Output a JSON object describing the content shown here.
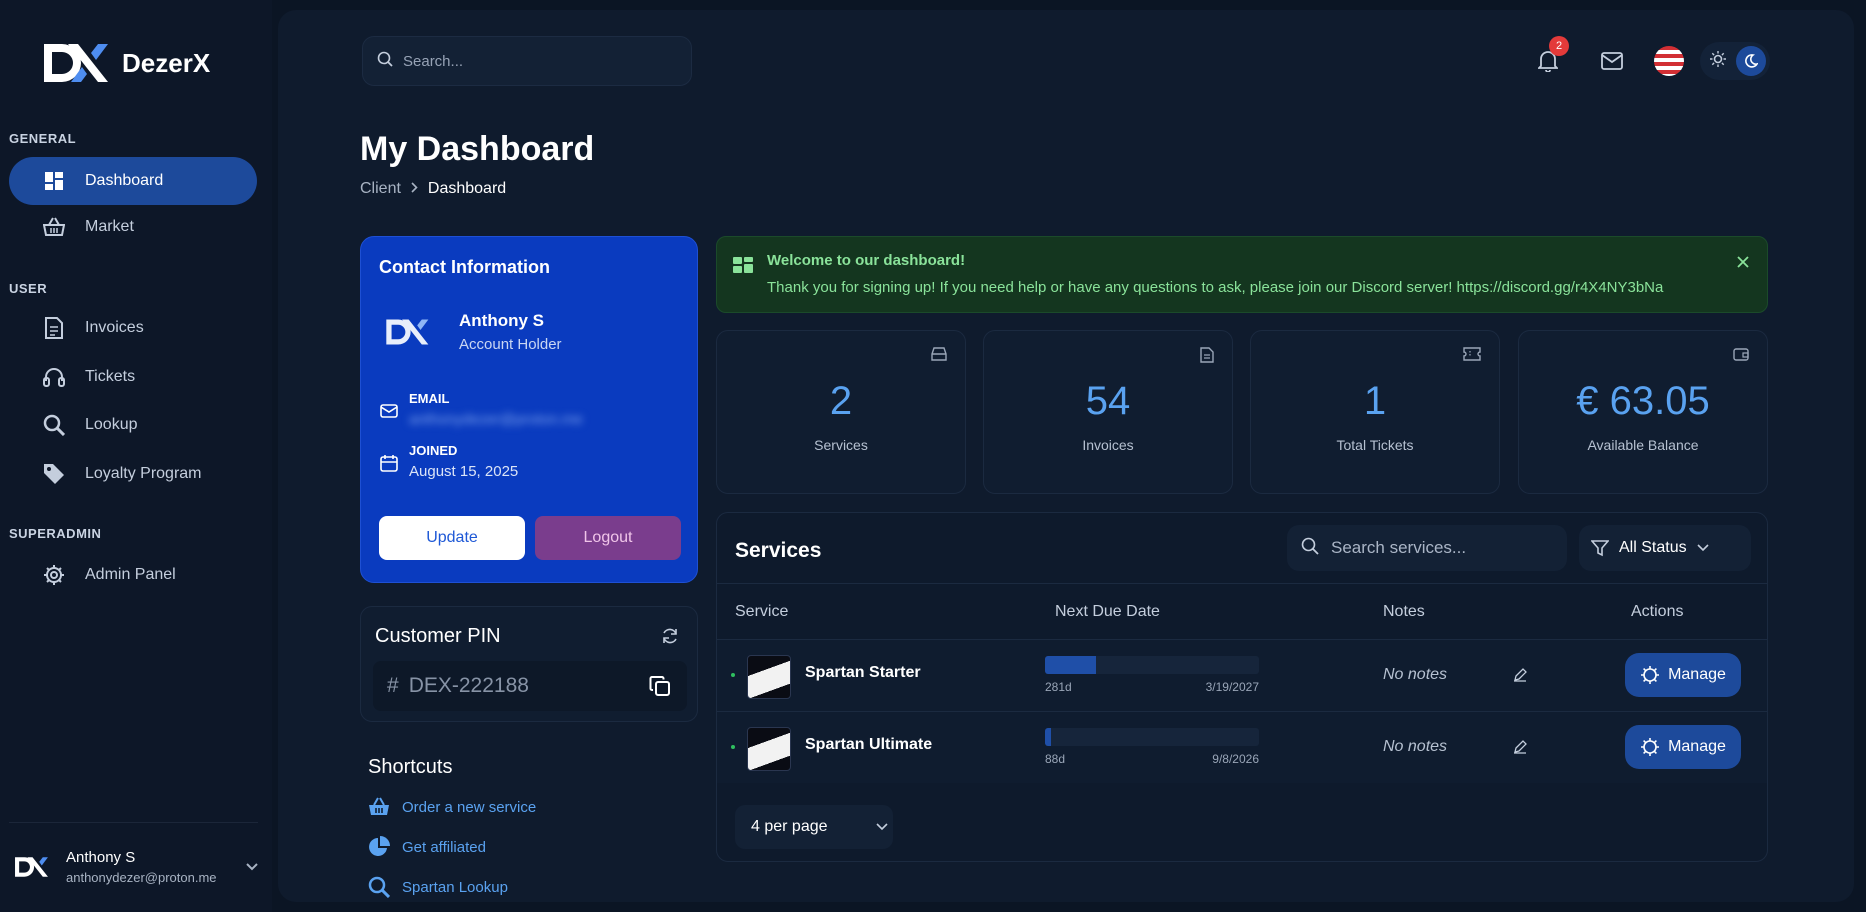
{
  "brand": {
    "name": "DezerX"
  },
  "sidebar": {
    "sections": [
      {
        "label": "GENERAL"
      },
      {
        "label": "USER"
      },
      {
        "label": "SUPERADMIN"
      }
    ],
    "items": [
      {
        "label": "Dashboard",
        "icon": "dashboard-icon",
        "active": true
      },
      {
        "label": "Market",
        "icon": "basket-icon"
      },
      {
        "label": "Invoices",
        "icon": "invoice-icon"
      },
      {
        "label": "Tickets",
        "icon": "headset-icon"
      },
      {
        "label": "Lookup",
        "icon": "search-icon"
      },
      {
        "label": "Loyalty Program",
        "icon": "tag-icon"
      },
      {
        "label": "Admin Panel",
        "icon": "gear-icon"
      }
    ],
    "user": {
      "name": "Anthony S",
      "email": "anthonydezer@proton.me"
    }
  },
  "topbar": {
    "search_placeholder": "Search...",
    "notification_count": "2"
  },
  "page": {
    "title": "My Dashboard",
    "breadcrumb": [
      "Client",
      "Dashboard"
    ]
  },
  "contact": {
    "title": "Contact Information",
    "name": "Anthony S",
    "role": "Account Holder",
    "email_label": "EMAIL",
    "email_value": "anthonydezer@proton.me",
    "joined_label": "JOINED",
    "joined_value": "August 15, 2025",
    "update_label": "Update",
    "logout_label": "Logout"
  },
  "pin": {
    "title": "Customer PIN",
    "value": "DEX-222188",
    "prefix": "#"
  },
  "shortcuts": {
    "title": "Shortcuts",
    "items": [
      {
        "label": "Order a new service",
        "icon": "basket-icon"
      },
      {
        "label": "Get affiliated",
        "icon": "pie-chart-icon"
      },
      {
        "label": "Spartan Lookup",
        "icon": "search-icon"
      }
    ]
  },
  "welcome": {
    "title": "Welcome to our dashboard!",
    "text": "Thank you for signing up! If you need help or have any questions to ask, please join our Discord server! https://discord.gg/r4X4NY3bNa"
  },
  "stats": [
    {
      "value": "2",
      "label": "Services",
      "icon": "server-icon"
    },
    {
      "value": "54",
      "label": "Invoices",
      "icon": "document-icon"
    },
    {
      "value": "1",
      "label": "Total Tickets",
      "icon": "ticket-icon"
    },
    {
      "value": "€ 63.05",
      "label": "Available Balance",
      "icon": "wallet-icon"
    }
  ],
  "services": {
    "title": "Services",
    "search_placeholder": "Search services...",
    "status_filter": "All Status",
    "columns": [
      "Service",
      "Next Due Date",
      "Notes",
      "Actions"
    ],
    "rows": [
      {
        "name": "Spartan Starter",
        "days": "281d",
        "due": "3/19/2027",
        "progress": 0.24,
        "notes": "No notes",
        "action": "Manage"
      },
      {
        "name": "Spartan Ultimate",
        "days": "88d",
        "due": "9/8/2026",
        "progress": 0.03,
        "notes": "No notes",
        "action": "Manage"
      }
    ],
    "per_page": "4 per page"
  },
  "colors": {
    "accent": "#5aa2f0",
    "active_nav": "#1d4a9b",
    "contact_card": "#0a3bbf",
    "welcome_text": "#8ae39a",
    "logout": "#7a3d8d"
  }
}
